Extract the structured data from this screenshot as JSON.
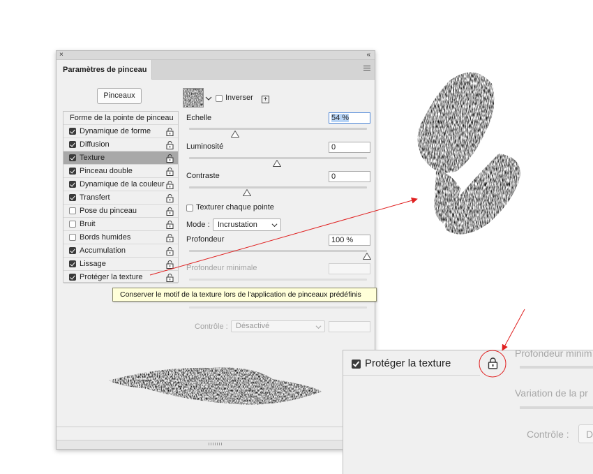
{
  "panel": {
    "close_glyph": "×",
    "collapse_glyph": "«",
    "tab_label": "Paramètres de pinceau",
    "menu_icon": "hamburger-icon",
    "brushes_button": "Pinceaux",
    "invert_label": "Inverser",
    "invert_checked": false,
    "new_texture_glyph": "+",
    "list": [
      {
        "label": "Forme de la pointe de pinceau",
        "header": true
      },
      {
        "label": "Dynamique de forme",
        "checked": true,
        "lock": true
      },
      {
        "label": "Diffusion",
        "checked": true,
        "lock": true
      },
      {
        "label": "Texture",
        "checked": true,
        "lock": true,
        "selected": true
      },
      {
        "label": "Pinceau double",
        "checked": true,
        "lock": true
      },
      {
        "label": "Dynamique de la couleur",
        "checked": true,
        "lock": true
      },
      {
        "label": "Transfert",
        "checked": true,
        "lock": true
      },
      {
        "label": "Pose du pinceau",
        "checked": false,
        "lock": true
      },
      {
        "label": "Bruit",
        "checked": false,
        "lock": true
      },
      {
        "label": "Bords humides",
        "checked": false,
        "lock": true
      },
      {
        "label": "Accumulation",
        "checked": true,
        "lock": true
      },
      {
        "label": "Lissage",
        "checked": true,
        "lock": true
      },
      {
        "label": "Protéger la texture",
        "checked": true,
        "lock": true
      }
    ],
    "scale": {
      "label": "Echelle",
      "value": "54 %",
      "level_percent": 54
    },
    "brightness": {
      "label": "Luminosité",
      "value": "0"
    },
    "contrast": {
      "label": "Contraste",
      "value": "0"
    },
    "texture_each_tip": {
      "label": "Texturer chaque pointe",
      "checked": false
    },
    "mode": {
      "label": "Mode :",
      "value": "Incrustation"
    },
    "depth": {
      "label": "Profondeur",
      "value": "100 %",
      "level_percent": 100
    },
    "min_depth": {
      "label": "Profondeur minimale",
      "value": ""
    },
    "control": {
      "label": "Contrôle :",
      "value": "Désactivé"
    },
    "tooltip": "Conserver le motif de la texture lors de l'application de pinceaux prédéfinis"
  },
  "zoom": {
    "label": "Protéger la texture",
    "checked": true,
    "faded_top": "Profondeur minim",
    "faded_mid": "Variation de la pr",
    "faded_control": "Contrôle :",
    "faded_control_value": "D"
  },
  "colors": {
    "annotation": "#e02020",
    "selection": "#a8a8a8",
    "tooltip_bg": "#ffffd9",
    "scale_highlight": "#b7d4f6"
  }
}
